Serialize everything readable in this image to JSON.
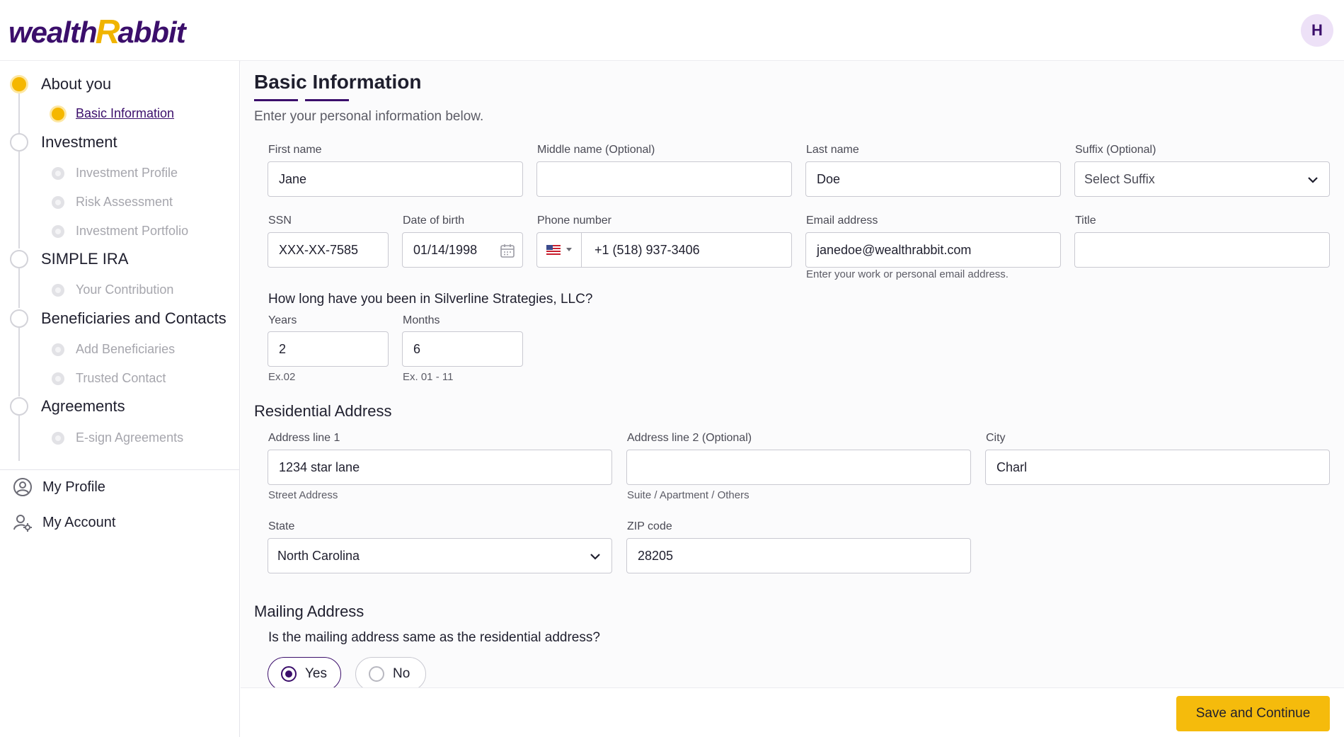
{
  "header": {
    "logo_left": "wealth",
    "logo_r": "R",
    "logo_right": "abbit",
    "avatar_initial": "H"
  },
  "sidebar": {
    "steps": [
      {
        "label": "About you",
        "subs": [
          "Basic Information"
        ]
      },
      {
        "label": "Investment",
        "subs": [
          "Investment Profile",
          "Risk Assessment",
          "Investment Portfolio"
        ]
      },
      {
        "label": "SIMPLE IRA",
        "subs": [
          "Your Contribution"
        ]
      },
      {
        "label": "Beneficiaries and Contacts",
        "subs": [
          "Add Beneficiaries",
          "Trusted Contact"
        ]
      },
      {
        "label": "Agreements",
        "subs": [
          "E-sign Agreements"
        ]
      }
    ],
    "links": {
      "profile": "My Profile",
      "account": "My Account"
    }
  },
  "form": {
    "title": "Basic Information",
    "subtitle": "Enter your personal information below.",
    "first_name": {
      "label": "First name",
      "value": "Jane"
    },
    "middle_name": {
      "label": "Middle name (Optional)",
      "value": ""
    },
    "last_name": {
      "label": "Last name",
      "value": "Doe"
    },
    "suffix": {
      "label": "Suffix (Optional)",
      "value": "Select Suffix"
    },
    "ssn": {
      "label": "SSN",
      "value": "XXX-XX-7585"
    },
    "dob": {
      "label": "Date of birth",
      "value": "01/14/1998"
    },
    "phone": {
      "label": "Phone number",
      "value": "+1 (518) 937-3406"
    },
    "email": {
      "label": "Email address",
      "value": "janedoe@wealthrabbit.com",
      "helper": "Enter your work or personal email address."
    },
    "title_field": {
      "label": "Title",
      "value": ""
    },
    "tenure": {
      "question": "How long have you been in Silverline Strategies, LLC?",
      "years": {
        "label": "Years",
        "value": "2",
        "helper": "Ex.02"
      },
      "months": {
        "label": "Months",
        "value": "6",
        "helper": "Ex. 01 - 11"
      }
    },
    "residential": {
      "title": "Residential Address",
      "line1": {
        "label": "Address line 1",
        "value": "1234 star lane",
        "helper": "Street Address"
      },
      "line2": {
        "label": "Address line 2 (Optional)",
        "value": "",
        "helper": "Suite / Apartment / Others"
      },
      "city": {
        "label": "City",
        "value": "Charl"
      },
      "state": {
        "label": "State",
        "value": "North Carolina"
      },
      "zip": {
        "label": "ZIP code",
        "value": "28205"
      }
    },
    "mailing": {
      "title": "Mailing Address",
      "question": "Is the mailing address same as the residential address?",
      "yes": "Yes",
      "no": "No"
    }
  },
  "footer": {
    "save_label": "Save and Continue"
  },
  "colors": {
    "brand": "#3b0e6b",
    "accent": "#f5bb0c"
  }
}
